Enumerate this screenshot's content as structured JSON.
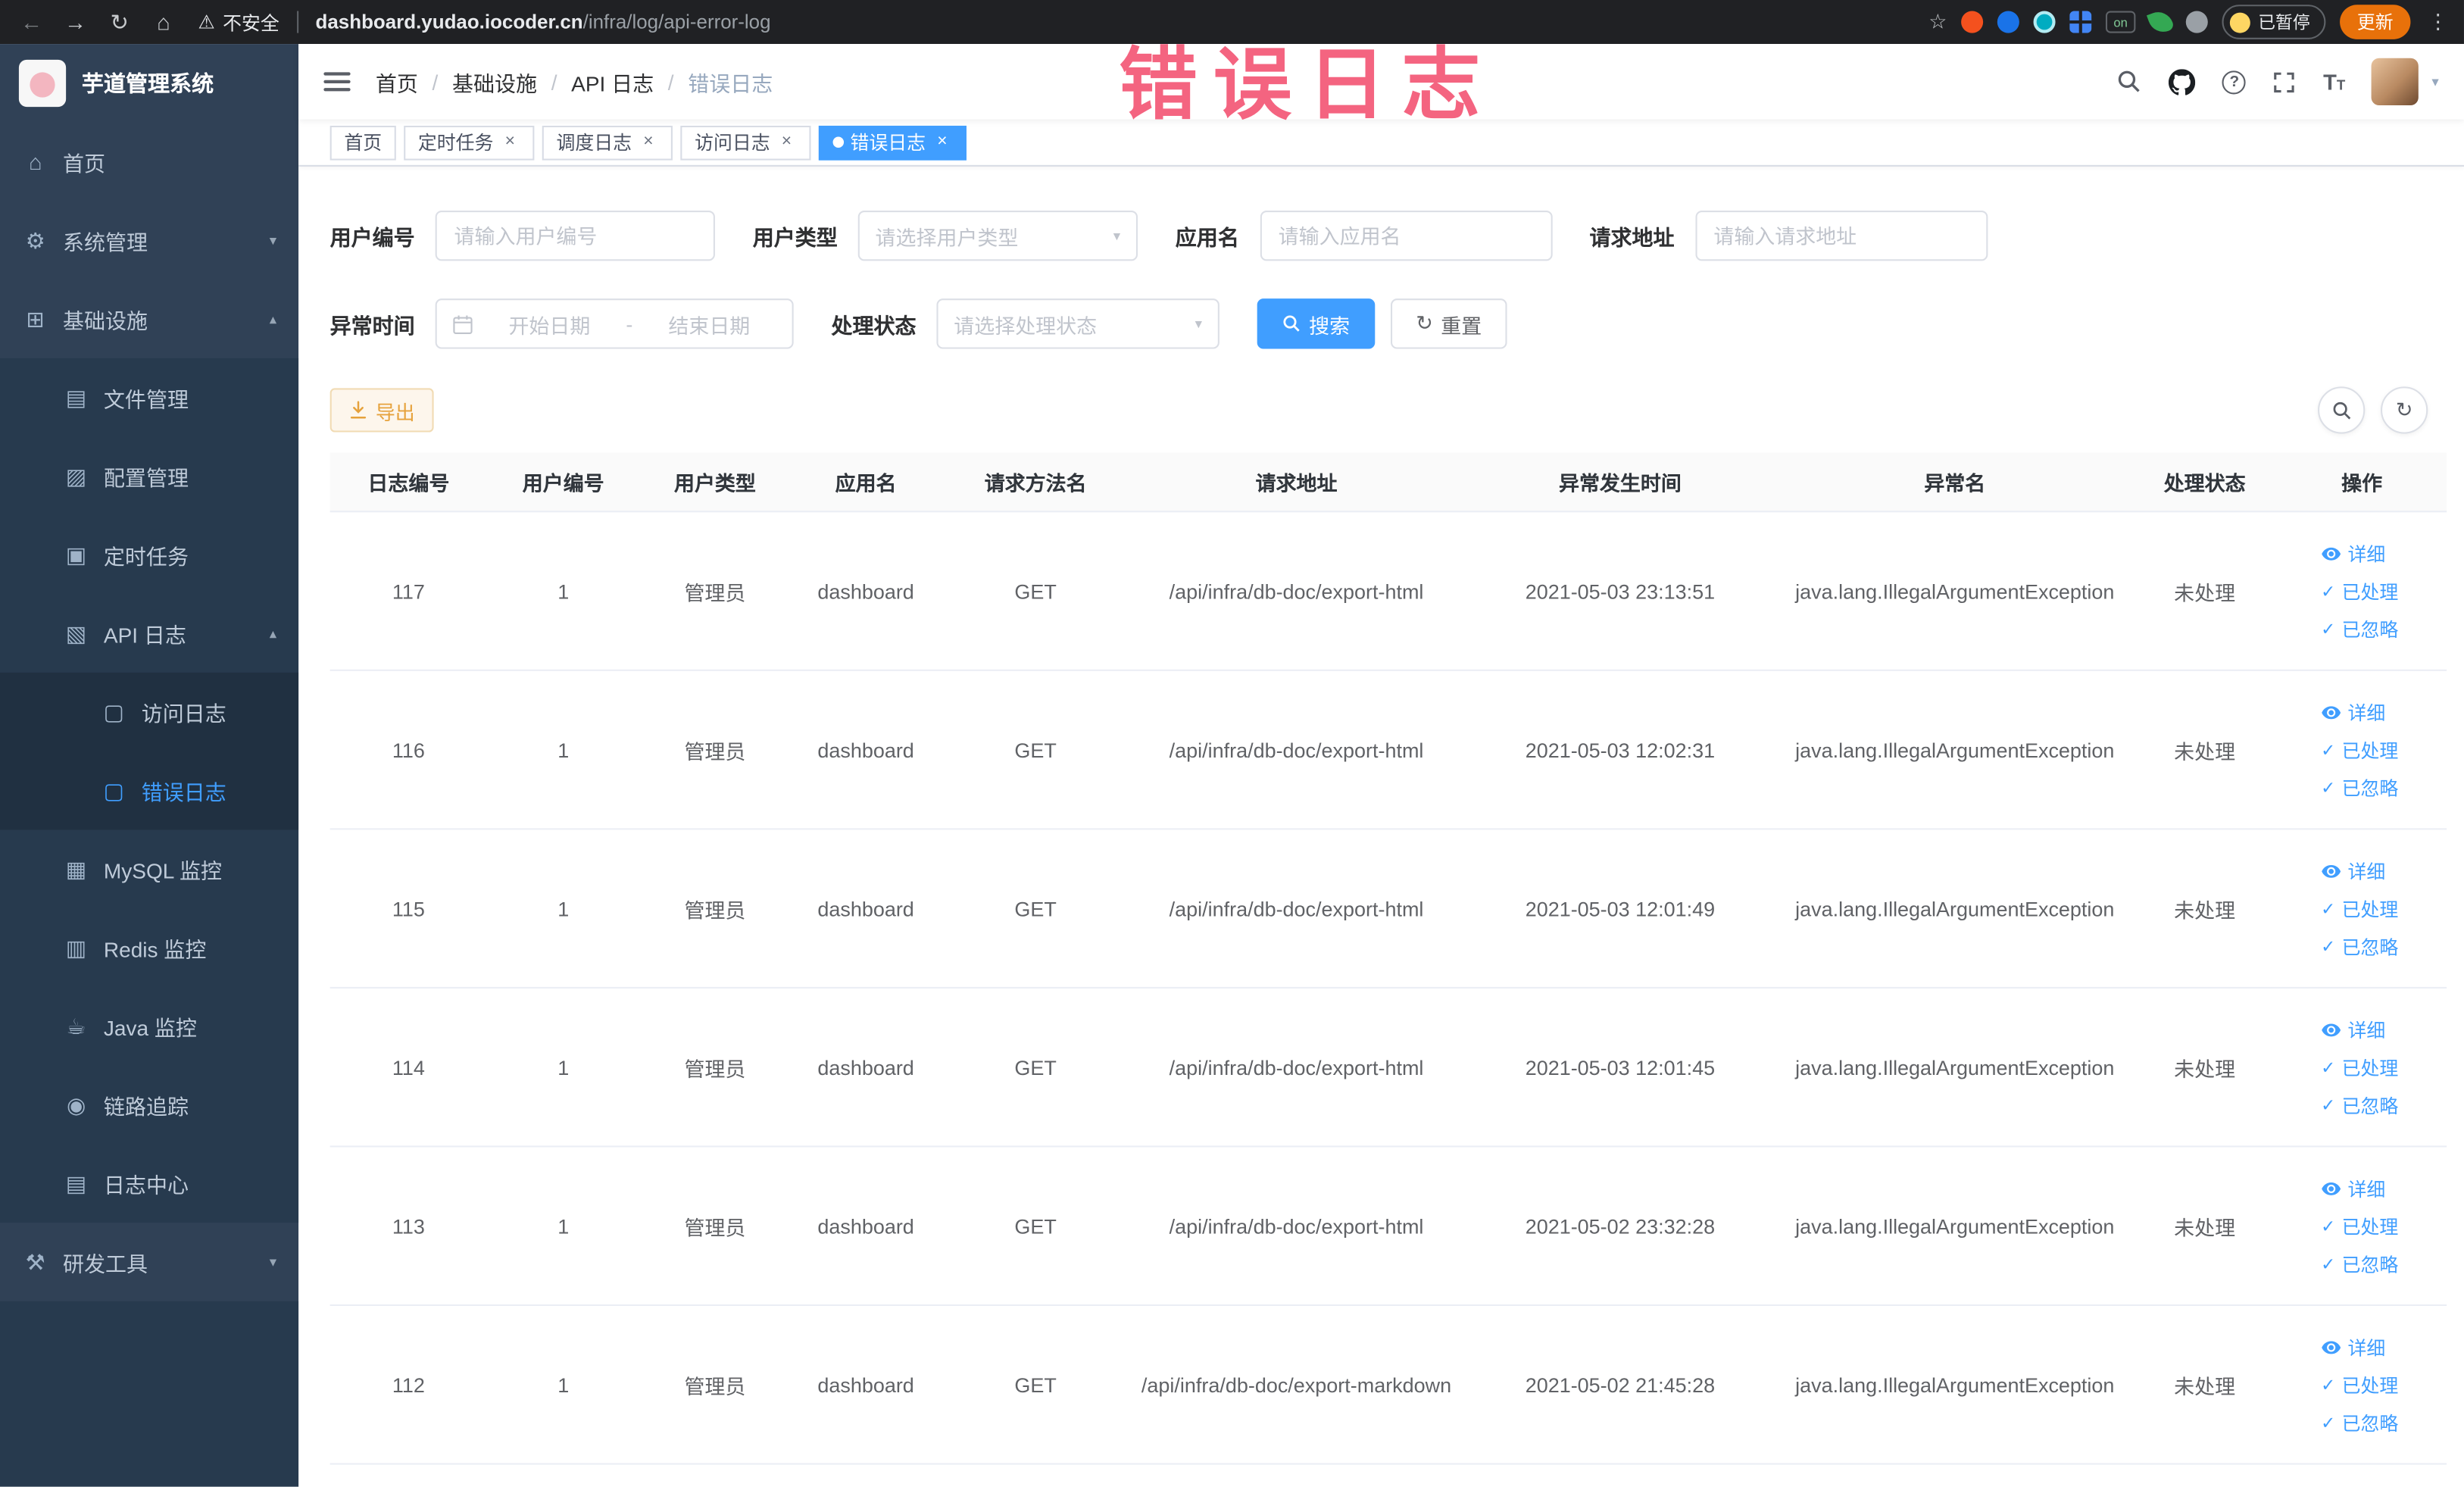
{
  "browser": {
    "security_label": "不安全",
    "url_host": "dashboard.yudao.iocoder.cn",
    "url_path": "/infra/log/api-error-log",
    "paused_badge": "已暂停",
    "update_button": "更新"
  },
  "watermark": "错误日志",
  "colors": {
    "accent": "#409eff",
    "warning": "#e6a23c",
    "sidebar_bg": "#304156",
    "watermark_pink": "#f34e6e"
  },
  "sidebar": {
    "title": "芋道管理系统",
    "items": {
      "home": "首页",
      "system": "系统管理",
      "infra": "基础设施",
      "file": "文件管理",
      "config": "配置管理",
      "job": "定时任务",
      "api_log": "API 日志",
      "access_log": "访问日志",
      "error_log": "错误日志",
      "mysql": "MySQL 监控",
      "redis": "Redis 监控",
      "java": "Java 监控",
      "trace": "链路追踪",
      "log_center": "日志中心",
      "dev": "研发工具"
    }
  },
  "breadcrumb": {
    "items": [
      "首页",
      "基础设施",
      "API 日志",
      "错误日志"
    ]
  },
  "tabs": [
    {
      "label": "首页",
      "closable": false,
      "active": false
    },
    {
      "label": "定时任务",
      "closable": true,
      "active": false
    },
    {
      "label": "调度日志",
      "closable": true,
      "active": false
    },
    {
      "label": "访问日志",
      "closable": true,
      "active": false
    },
    {
      "label": "错误日志",
      "closable": true,
      "active": true
    }
  ],
  "filters": {
    "user_id": {
      "label": "用户编号",
      "placeholder": "请输入用户编号"
    },
    "user_type": {
      "label": "用户类型",
      "placeholder": "请选择用户类型"
    },
    "app_name": {
      "label": "应用名",
      "placeholder": "请输入应用名"
    },
    "request_url": {
      "label": "请求地址",
      "placeholder": "请输入请求地址"
    },
    "exception_time": {
      "label": "异常时间",
      "start_placeholder": "开始日期",
      "separator": "-",
      "end_placeholder": "结束日期"
    },
    "process_status": {
      "label": "处理状态",
      "placeholder": "请选择处理状态"
    },
    "search_button": "搜索",
    "reset_button": "重置"
  },
  "toolbar": {
    "export_button": "导出"
  },
  "table": {
    "columns": [
      "日志编号",
      "用户编号",
      "用户类型",
      "应用名",
      "请求方法名",
      "请求地址",
      "异常发生时间",
      "异常名",
      "处理状态",
      "操作"
    ],
    "actions": [
      "详细",
      "已处理",
      "已忽略"
    ],
    "rows": [
      {
        "id": "117",
        "user_id": "1",
        "user_type": "管理员",
        "app_name": "dashboard",
        "method": "GET",
        "url": "/api/infra/db-doc/export-html",
        "time": "2021-05-03 23:13:51",
        "exception": "java.lang.IllegalArgumentException",
        "status": "未处理"
      },
      {
        "id": "116",
        "user_id": "1",
        "user_type": "管理员",
        "app_name": "dashboard",
        "method": "GET",
        "url": "/api/infra/db-doc/export-html",
        "time": "2021-05-03 12:02:31",
        "exception": "java.lang.IllegalArgumentException",
        "status": "未处理"
      },
      {
        "id": "115",
        "user_id": "1",
        "user_type": "管理员",
        "app_name": "dashboard",
        "method": "GET",
        "url": "/api/infra/db-doc/export-html",
        "time": "2021-05-03 12:01:49",
        "exception": "java.lang.IllegalArgumentException",
        "status": "未处理"
      },
      {
        "id": "114",
        "user_id": "1",
        "user_type": "管理员",
        "app_name": "dashboard",
        "method": "GET",
        "url": "/api/infra/db-doc/export-html",
        "time": "2021-05-03 12:01:45",
        "exception": "java.lang.IllegalArgumentException",
        "status": "未处理"
      },
      {
        "id": "113",
        "user_id": "1",
        "user_type": "管理员",
        "app_name": "dashboard",
        "method": "GET",
        "url": "/api/infra/db-doc/export-html",
        "time": "2021-05-02 23:32:28",
        "exception": "java.lang.IllegalArgumentException",
        "status": "未处理"
      },
      {
        "id": "112",
        "user_id": "1",
        "user_type": "管理员",
        "app_name": "dashboard",
        "method": "GET",
        "url": "/api/infra/db-doc/export-markdown",
        "time": "2021-05-02 21:45:28",
        "exception": "java.lang.IllegalArgumentException",
        "status": "未处理"
      }
    ]
  }
}
